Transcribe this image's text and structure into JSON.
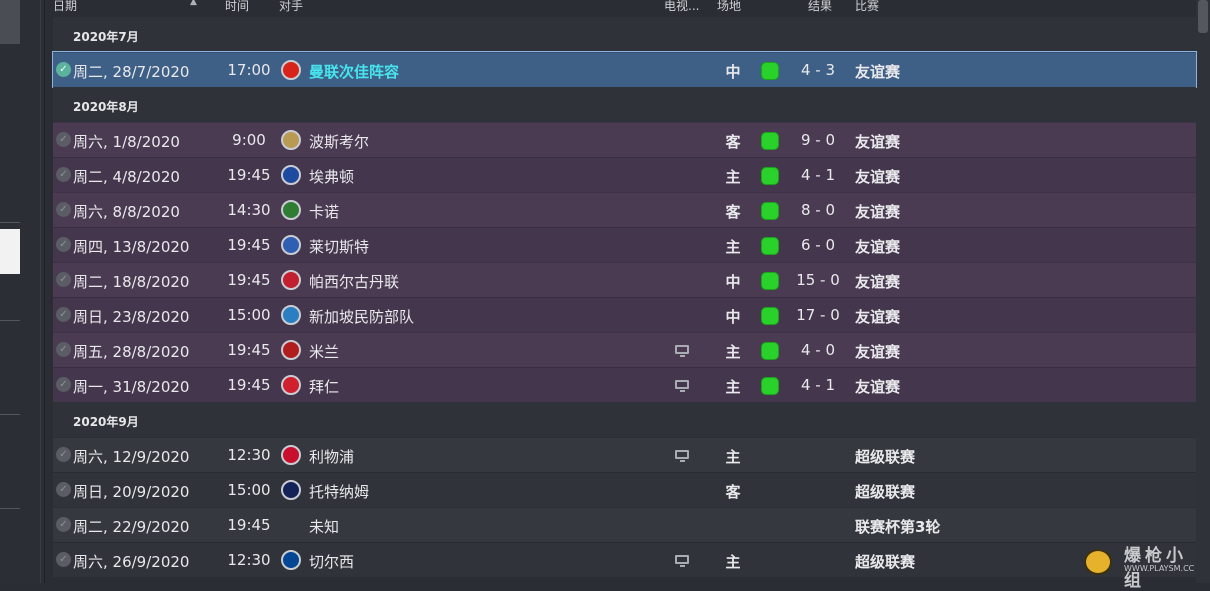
{
  "header": {
    "date": "日期",
    "time": "时间",
    "opponent": "对手",
    "tv": "电视...",
    "venue": "场地",
    "result": "结果",
    "competition": "比赛"
  },
  "groups": {
    "july": "2020年7月",
    "august": "2020年8月",
    "september": "2020年9月"
  },
  "fixtures": [
    {
      "date": "周二, 28/7/2020",
      "time": "17:00",
      "opponent": "曼联次佳阵容",
      "crest_color": "#d8231b",
      "venue": "中",
      "result": "4 - 3",
      "competition": "友谊赛"
    },
    {
      "date": "周六, 1/8/2020",
      "time": "9:00",
      "opponent": "波斯考尔",
      "crest_color": "#b99a52",
      "venue": "客",
      "result": "9 - 0",
      "competition": "友谊赛"
    },
    {
      "date": "周二, 4/8/2020",
      "time": "19:45",
      "opponent": "埃弗顿",
      "crest_color": "#1e4aa0",
      "venue": "主",
      "result": "4 - 1",
      "competition": "友谊赛"
    },
    {
      "date": "周六, 8/8/2020",
      "time": "14:30",
      "opponent": "卡诺",
      "crest_color": "#2e7d32",
      "venue": "客",
      "result": "8 - 0",
      "competition": "友谊赛"
    },
    {
      "date": "周四, 13/8/2020",
      "time": "19:45",
      "opponent": "莱切斯特",
      "crest_color": "#2f5fb3",
      "venue": "主",
      "result": "6 - 0",
      "competition": "友谊赛"
    },
    {
      "date": "周二, 18/8/2020",
      "time": "19:45",
      "opponent": "帕西尔古丹联",
      "crest_color": "#c3202f",
      "venue": "中",
      "result": "15 - 0",
      "competition": "友谊赛"
    },
    {
      "date": "周日, 23/8/2020",
      "time": "15:00",
      "opponent": "新加坡民防部队",
      "crest_color": "#2a7fc1",
      "venue": "中",
      "result": "17 - 0",
      "competition": "友谊赛"
    },
    {
      "date": "周五, 28/8/2020",
      "time": "19:45",
      "opponent": "米兰",
      "crest_color": "#b11d1d",
      "tv": true,
      "venue": "主",
      "result": "4 - 0",
      "competition": "友谊赛"
    },
    {
      "date": "周一, 31/8/2020",
      "time": "19:45",
      "opponent": "拜仁",
      "crest_color": "#d0202e",
      "tv": true,
      "venue": "主",
      "result": "4 - 1",
      "competition": "友谊赛"
    },
    {
      "date": "周六, 12/9/2020",
      "time": "12:30",
      "opponent": "利物浦",
      "crest_color": "#c8102e",
      "tv": true,
      "venue": "主",
      "result": "",
      "competition": "超级联赛"
    },
    {
      "date": "周日, 20/9/2020",
      "time": "15:00",
      "opponent": "托特纳姆",
      "crest_color": "#132257",
      "venue": "客",
      "result": "",
      "competition": "超级联赛"
    },
    {
      "date": "周二, 22/9/2020",
      "time": "19:45",
      "opponent": "未知",
      "crest_color": "",
      "venue": "",
      "result": "",
      "competition": "联赛杯第3轮"
    },
    {
      "date": "周六, 26/9/2020",
      "time": "12:30",
      "opponent": "切尔西",
      "crest_color": "#034694",
      "tv": true,
      "venue": "主",
      "result": "",
      "competition": "超级联赛"
    }
  ],
  "watermark": {
    "text": "爆枪小组",
    "url": "WWW.PLAYSM.CC"
  }
}
